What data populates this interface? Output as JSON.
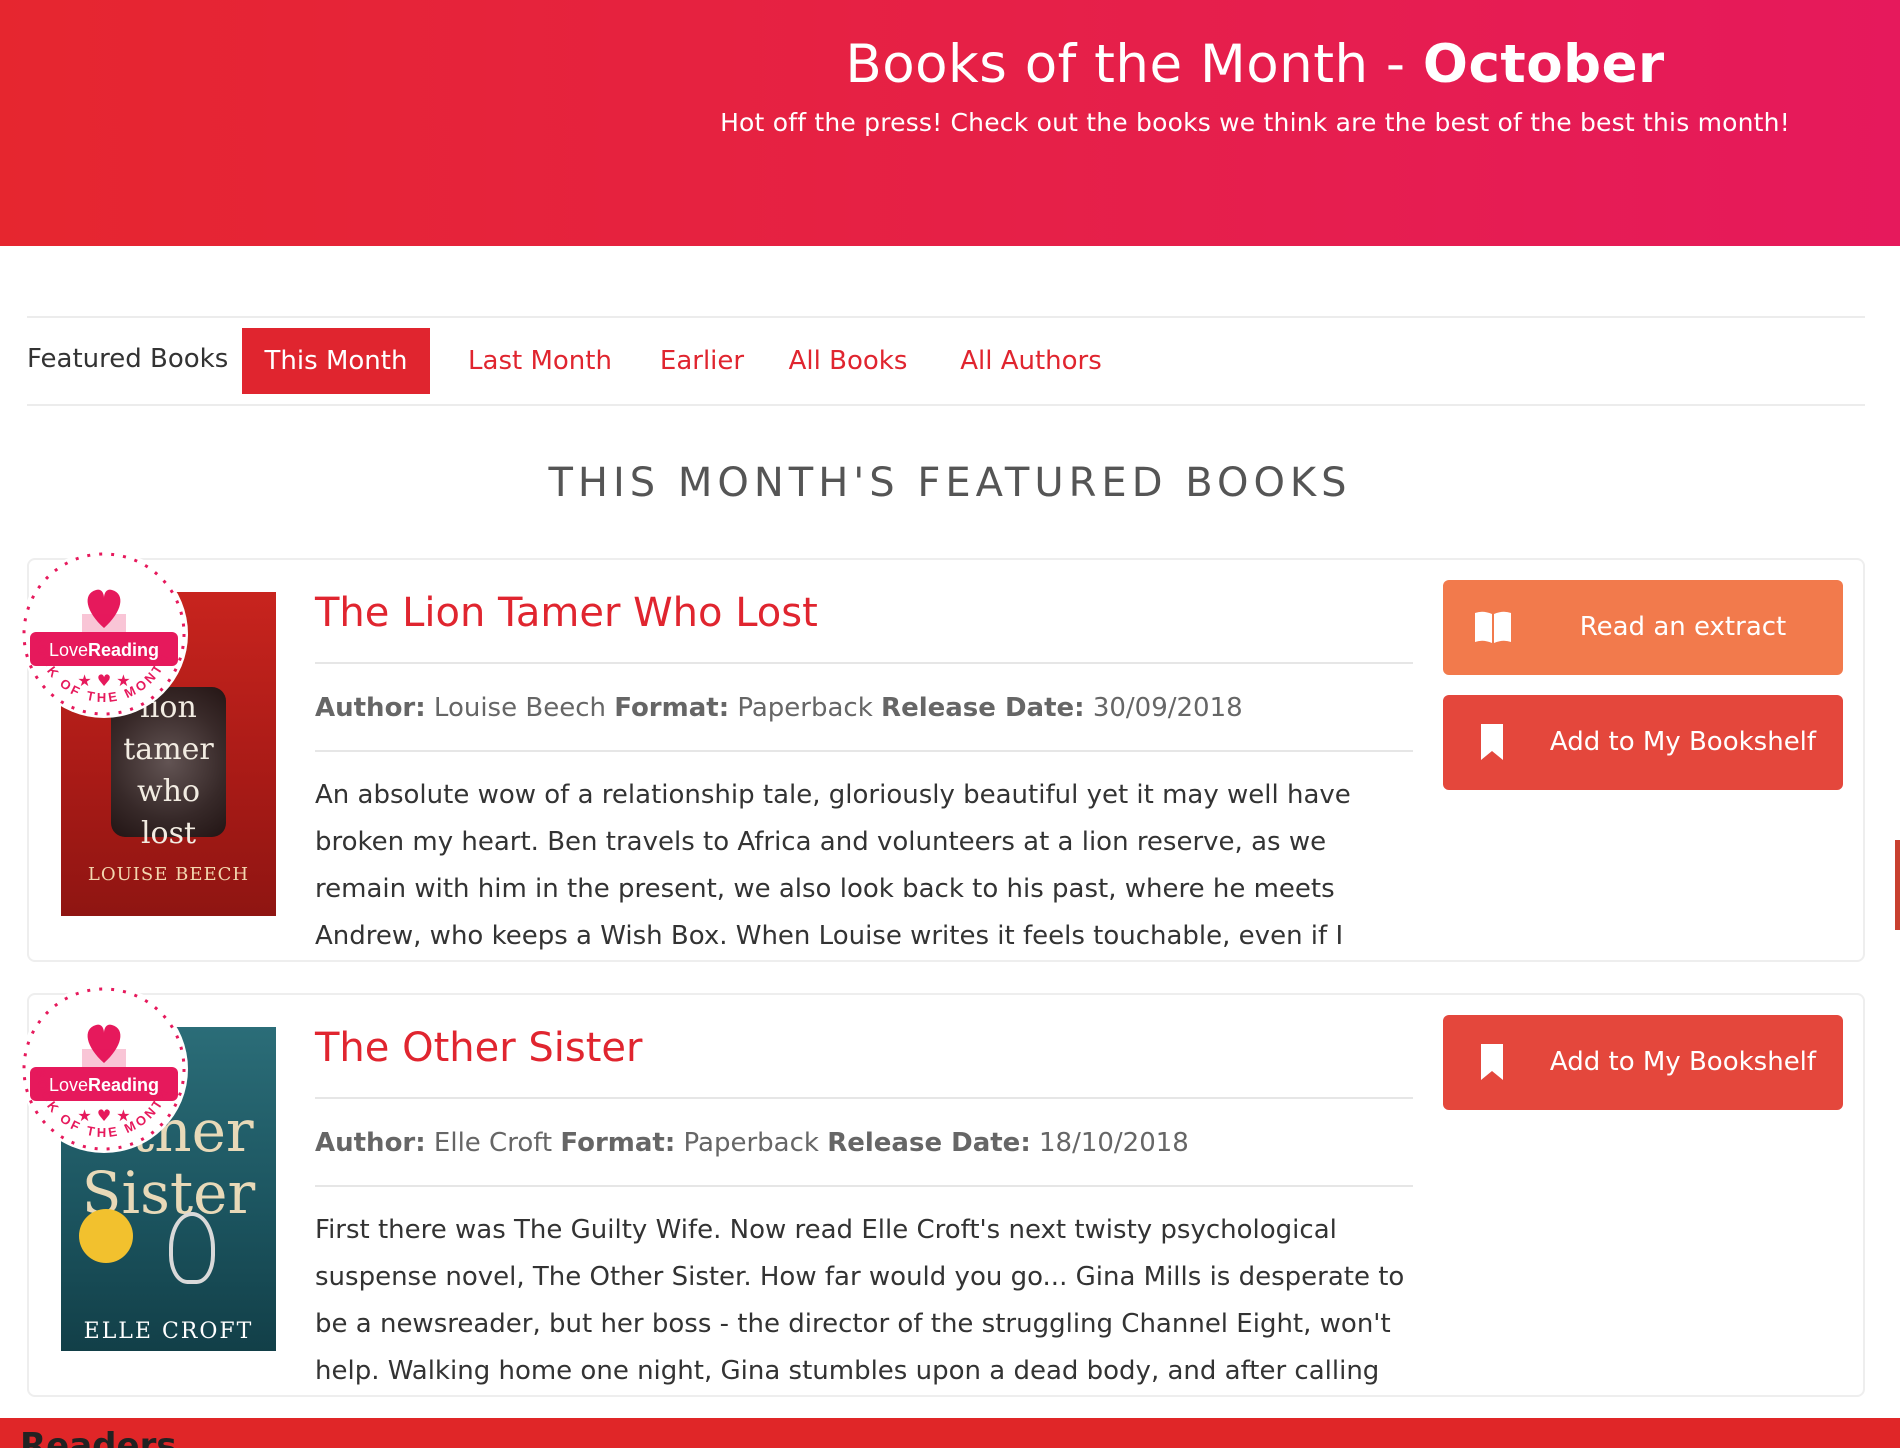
{
  "hero": {
    "title_prefix": "Books of the Month - ",
    "title_month": "October",
    "subtitle": "Hot off the press! Check out the books we think are the best of the best this month!"
  },
  "nav": {
    "label": "Featured Books",
    "tabs": [
      {
        "label": "This Month",
        "active": true
      },
      {
        "label": "Last Month",
        "active": false
      },
      {
        "label": "Earlier",
        "active": false
      },
      {
        "label": "All Books",
        "active": false
      },
      {
        "label": "All Authors",
        "active": false
      }
    ]
  },
  "section_heading": "THIS MONTH'S FEATURED BOOKS",
  "badge": {
    "brand_love": "Love",
    "brand_reading": "Reading",
    "ring_text": "BOOK OF THE MONTH"
  },
  "labels": {
    "author": "Author:",
    "format": "Format:",
    "release_date": "Release Date:"
  },
  "books": [
    {
      "title": "The Lion Tamer Who Lost",
      "author": "Louise Beech",
      "format": "Paperback",
      "release_date": "30/09/2018",
      "description": "An absolute wow of a relationship tale, gloriously beautiful yet it may well have broken my heart. Ben travels to Africa and volunteers at a lion reserve, as we remain with him in the present, we also look back to his past, where he meets Andrew, who keeps a Wish Box. When Louise writes it feels touchable, even if I",
      "cover_lines": [
        "lion",
        "tamer",
        "who",
        "lost"
      ],
      "cover_author": "LOUISE BEECH",
      "buttons": {
        "extract": "Read an extract",
        "bookshelf": "Add to My Bookshelf"
      }
    },
    {
      "title": "The Other Sister",
      "author": "Elle Croft",
      "format": "Paperback",
      "release_date": "18/10/2018",
      "description": "First there was The Guilty Wife. Now read Elle Croft's next twisty psychological suspense novel, The Other Sister. How far would you go... Gina Mills is desperate to be a newsreader, but her boss - the director of the struggling Channel Eight, won't help. Walking home one night, Gina stumbles upon a dead body, and after calling",
      "cover_lines": [
        "Other",
        "Sister"
      ],
      "cover_author": "ELLE CROFT",
      "buttons": {
        "bookshelf": "Add to My Bookshelf"
      }
    }
  ],
  "footer_partial_text": "Readers",
  "colors": {
    "brand_red": "#e0252f",
    "extract_orange": "#f27a4c",
    "bookshelf_red": "#e4473c",
    "badge_pink": "#e6195c"
  }
}
